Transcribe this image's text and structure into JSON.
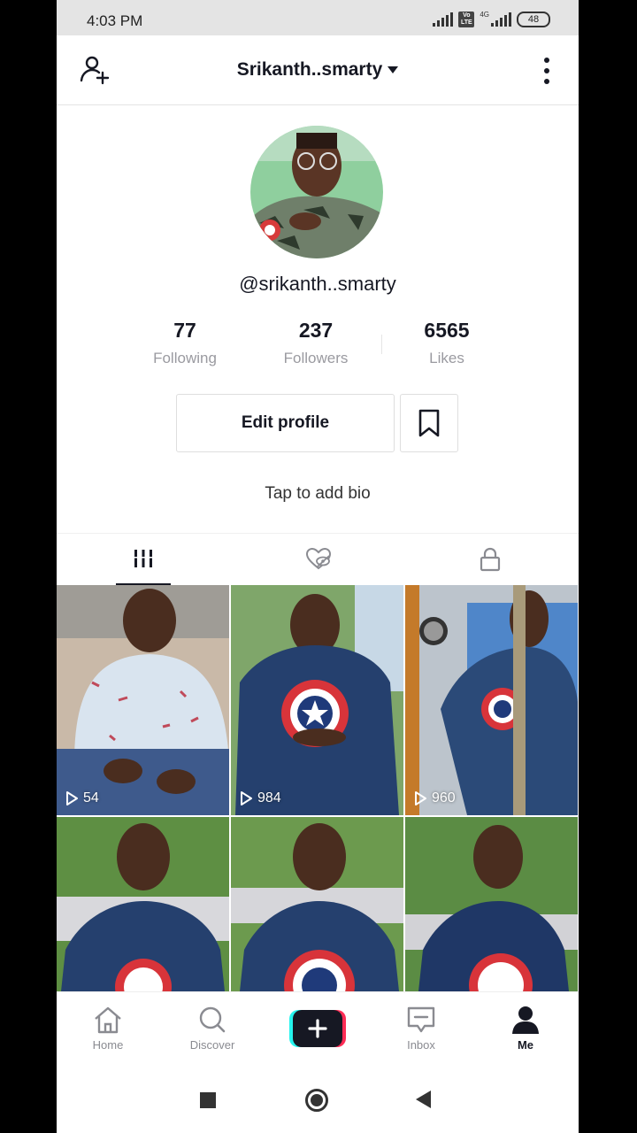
{
  "status_bar": {
    "time": "4:03 PM",
    "volte": "Vo LTE",
    "network": "4G",
    "battery": "48"
  },
  "header": {
    "title": "Srikanth..smarty"
  },
  "profile": {
    "handle": "@srikanth..smarty",
    "stats": [
      {
        "value": "77",
        "label": "Following"
      },
      {
        "value": "237",
        "label": "Followers"
      },
      {
        "value": "6565",
        "label": "Likes"
      }
    ],
    "edit_button": "Edit profile",
    "bio_prompt": "Tap to add bio"
  },
  "videos": [
    {
      "views": "54"
    },
    {
      "views": "984"
    },
    {
      "views": "960"
    },
    {
      "views": ""
    },
    {
      "views": ""
    },
    {
      "views": ""
    }
  ],
  "bottom_nav": [
    {
      "label": "Home",
      "icon": "home-icon"
    },
    {
      "label": "Discover",
      "icon": "search-icon"
    },
    {
      "label": "",
      "icon": "create-plus-icon"
    },
    {
      "label": "Inbox",
      "icon": "inbox-icon"
    },
    {
      "label": "Me",
      "icon": "profile-icon"
    }
  ],
  "colors": {
    "accent_pink": "#fe2c55",
    "accent_cyan": "#25f4ee",
    "text_dark": "#161823",
    "text_muted": "#9a9aa0"
  }
}
